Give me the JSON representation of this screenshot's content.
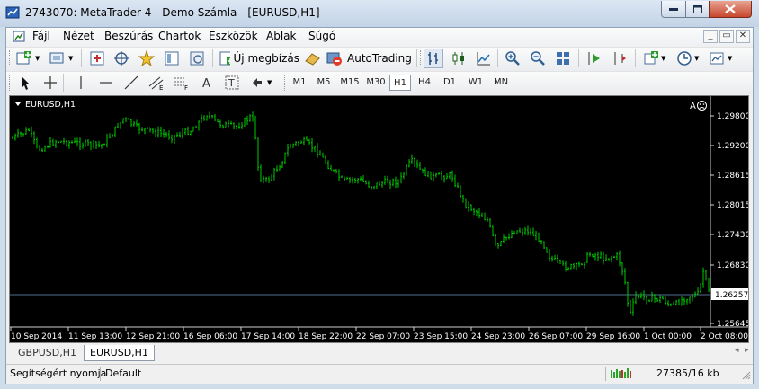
{
  "window": {
    "title": "2743070: MetaTrader 4 - Demo Számla - [EURUSD,H1]",
    "buttons": {
      "minimize": "—",
      "maximize": "☐",
      "close": "✕"
    }
  },
  "menu": {
    "items": [
      "Fájl",
      "Nézet",
      "Beszúrás",
      "Chartok",
      "Eszközök",
      "Ablak",
      "Súgó"
    ],
    "mdi_controls": [
      "_",
      "▭",
      "✕"
    ]
  },
  "toolbar": {
    "new_order_label": "Új megbízás",
    "autotrading_label": "AutoTrading"
  },
  "timeframes": {
    "items": [
      "M1",
      "M5",
      "M15",
      "M30",
      "H1",
      "H4",
      "D1",
      "W1",
      "MN"
    ],
    "active": "H1"
  },
  "chart": {
    "symbol_label": "EURUSD,H1",
    "corner_label": "A",
    "price_line_color": "#4f6f8f",
    "candle_color": "#00c800",
    "price_labels": [
      "1.29800",
      "1.29200",
      "1.28615",
      "1.28015",
      "1.27430",
      "1.26830",
      "1.26257",
      "1.25645"
    ],
    "current_price": "1.26257",
    "date_labels": [
      "10 Sep 2014",
      "11 Sep 13:00",
      "12 Sep 21:00",
      "16 Sep 06:00",
      "17 Sep 14:00",
      "18 Sep 22:00",
      "22 Sep 07:00",
      "23 Sep 15:00",
      "24 Sep 23:00",
      "26 Sep 07:00",
      "29 Sep 16:00",
      "1 Oct 00:00",
      "2 Oct 08:00"
    ]
  },
  "tabs": {
    "items": [
      "GBPUSD,H1",
      "EURUSD,H1"
    ],
    "active": "EURUSD,H1"
  },
  "status": {
    "help_text": "Segítségért nyomja",
    "profile": "Default",
    "traffic": "27385/16 kb"
  }
}
